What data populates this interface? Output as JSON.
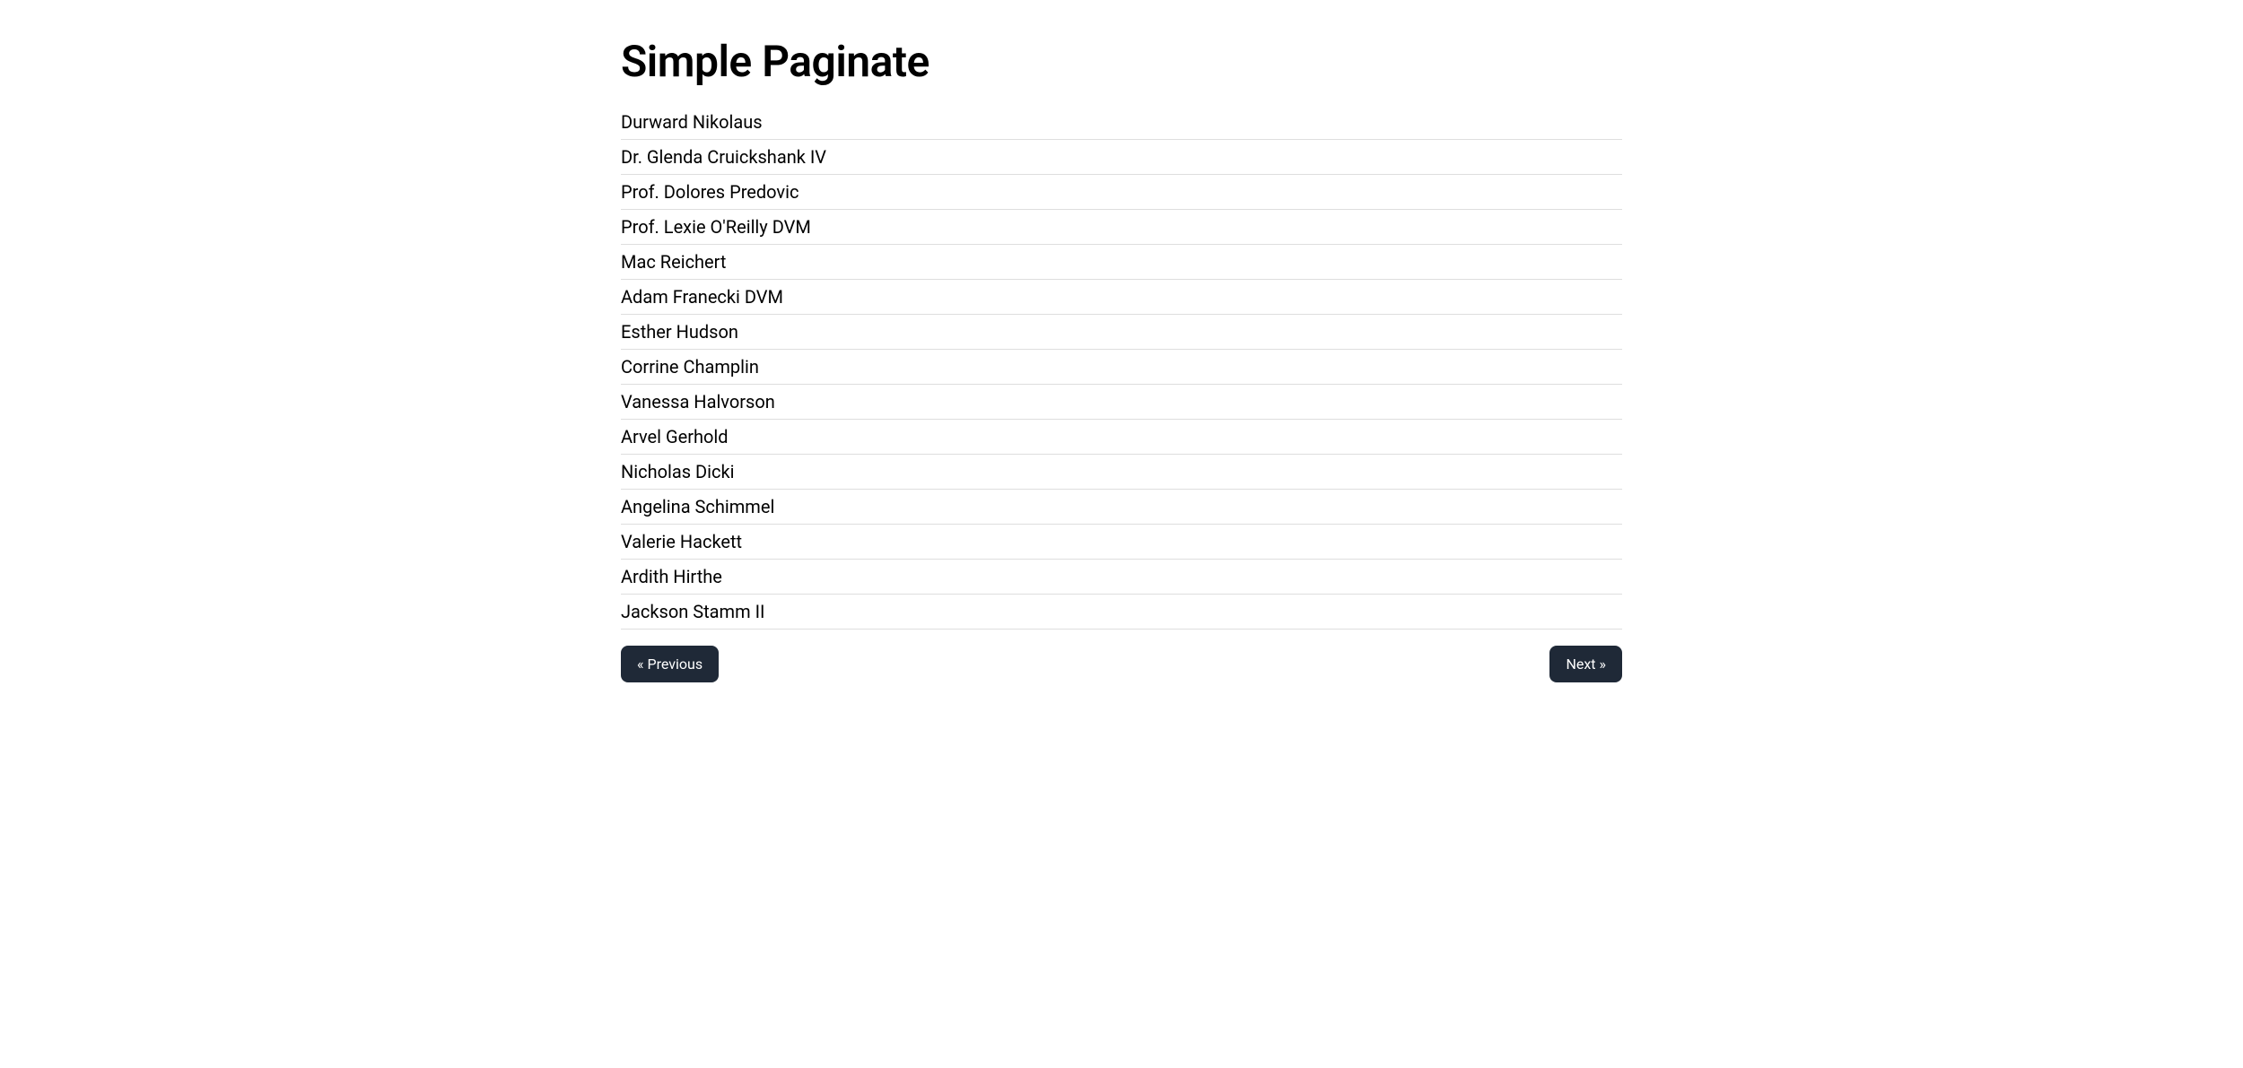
{
  "title": "Simple Paginate",
  "items": [
    "Durward Nikolaus",
    "Dr. Glenda Cruickshank IV",
    "Prof. Dolores Predovic",
    "Prof. Lexie O'Reilly DVM",
    "Mac Reichert",
    "Adam Franecki DVM",
    "Esther Hudson",
    "Corrine Champlin",
    "Vanessa Halvorson",
    "Arvel Gerhold",
    "Nicholas Dicki",
    "Angelina Schimmel",
    "Valerie Hackett",
    "Ardith Hirthe",
    "Jackson Stamm II"
  ],
  "pagination": {
    "previous_label": "« Previous",
    "next_label": "Next »"
  }
}
